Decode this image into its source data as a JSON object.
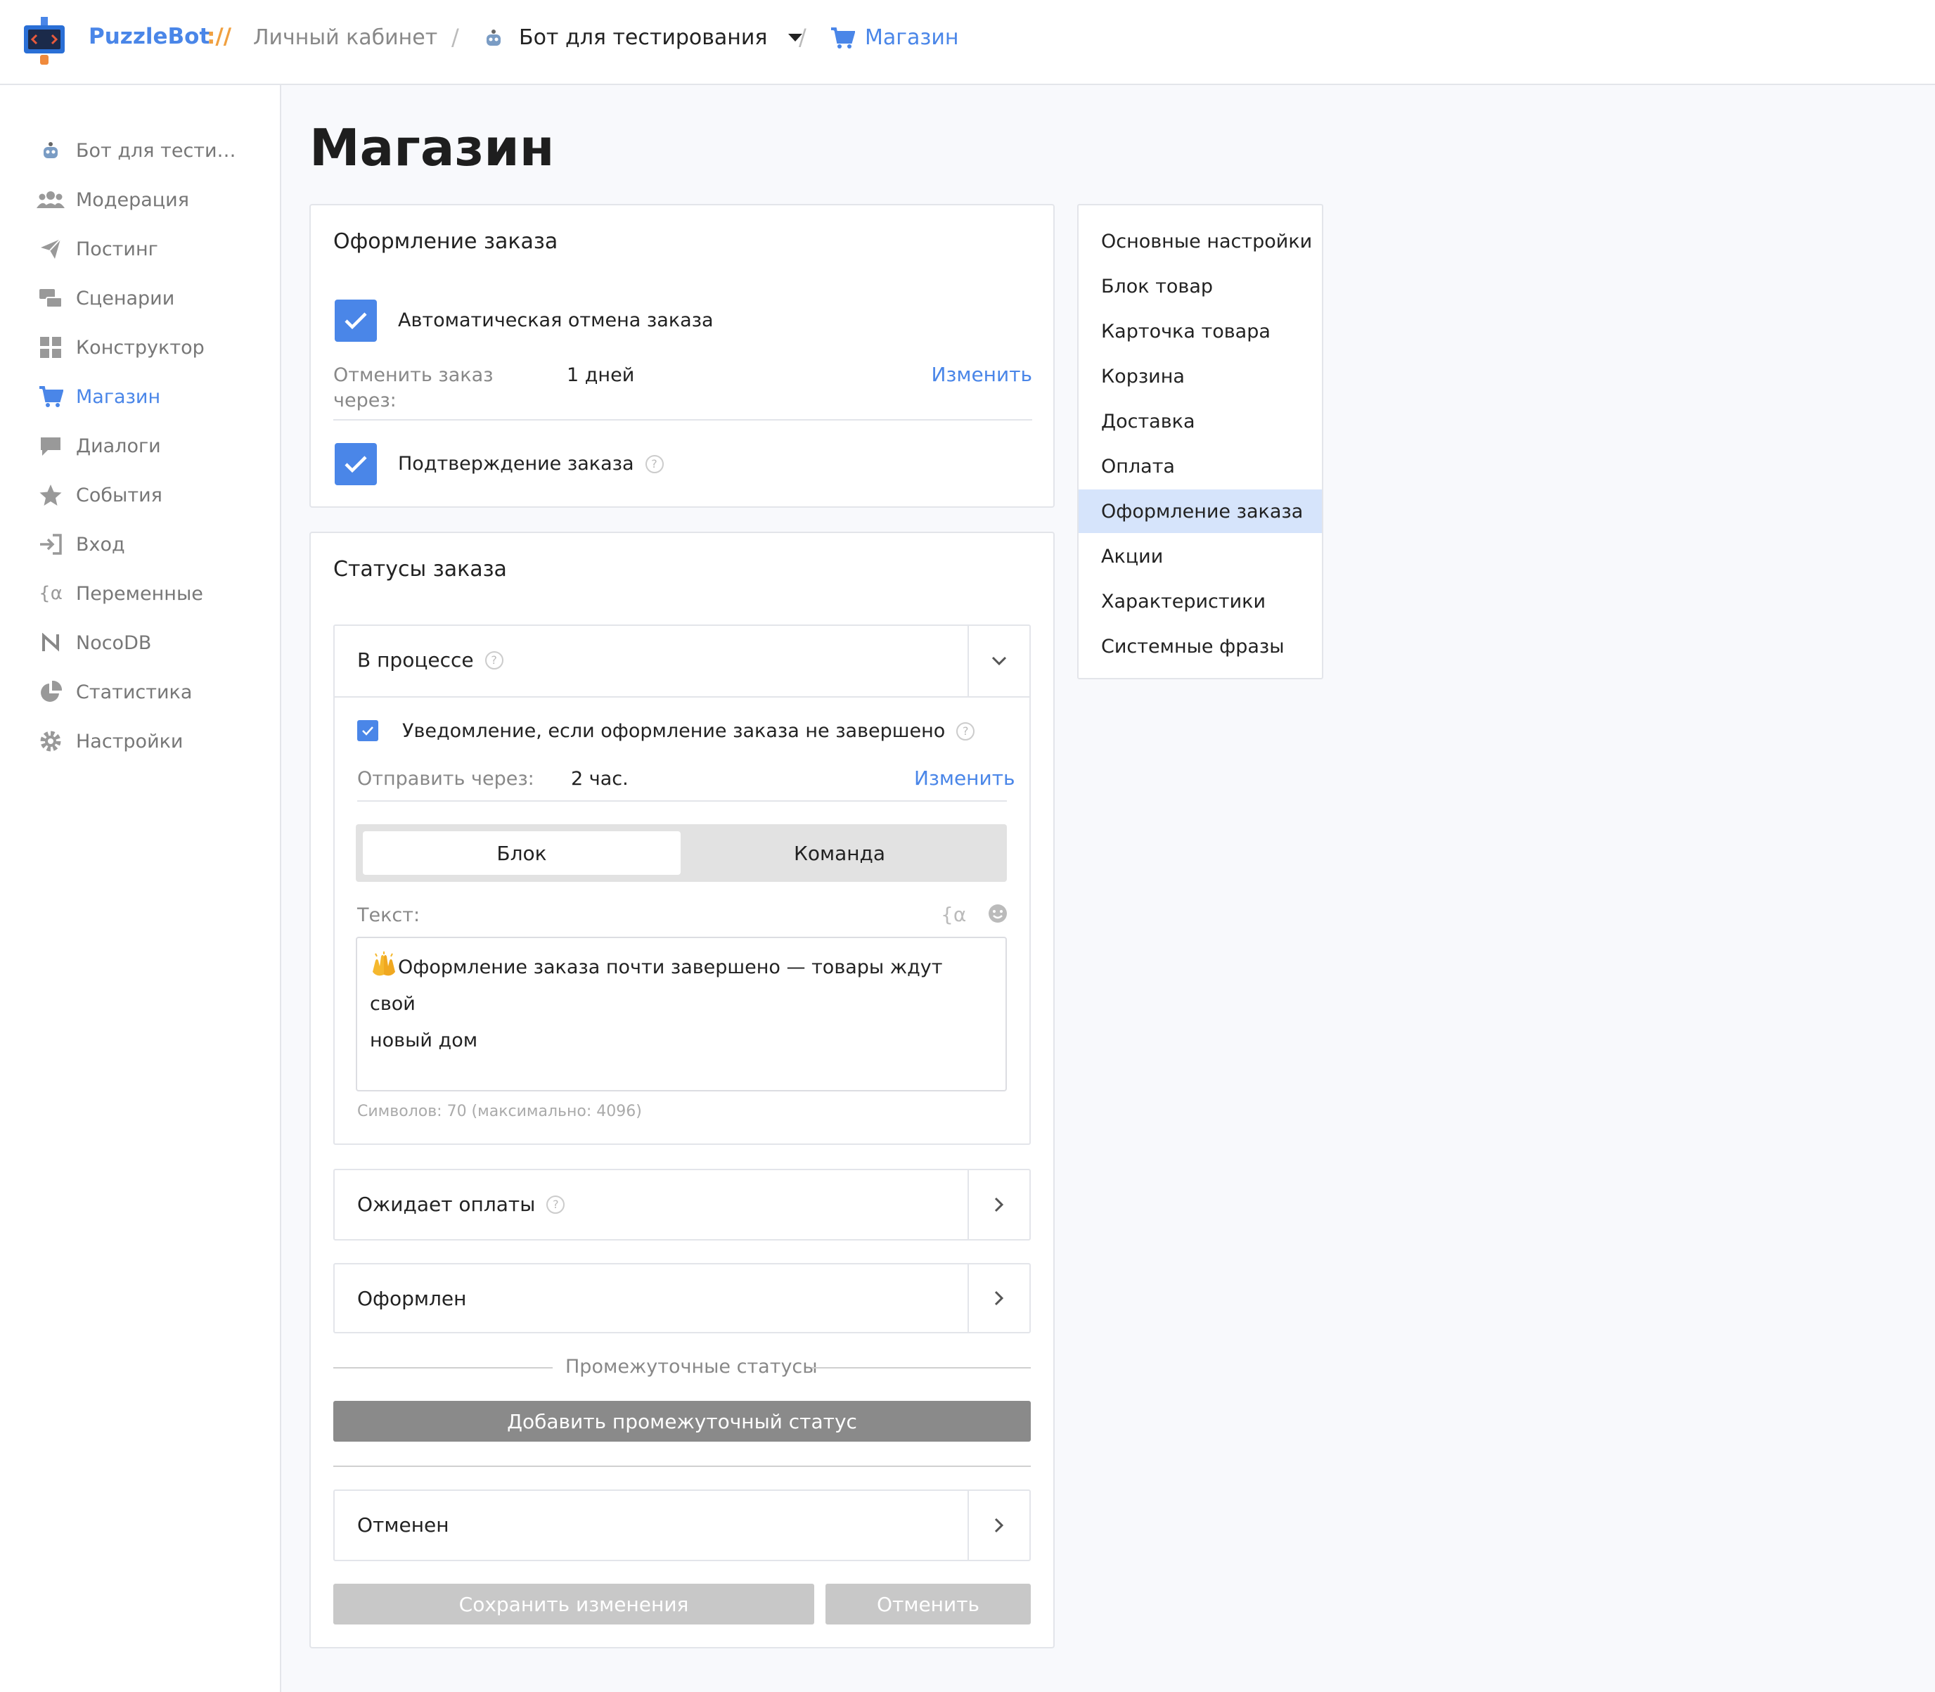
{
  "header": {
    "brand": "PuzzleBot",
    "brand_sep": "://",
    "crumb_cabinet": "Личный кабинет",
    "crumb_bot": "Бот для тестирования",
    "crumb_shop": "Магазин",
    "slash": "/"
  },
  "sidebar": {
    "items": [
      {
        "label": "Бот для тести…",
        "icon": "robot-icon"
      },
      {
        "label": "Модерация",
        "icon": "users-icon"
      },
      {
        "label": "Постинг",
        "icon": "paper-plane-icon"
      },
      {
        "label": "Сценарии",
        "icon": "scenarios-icon"
      },
      {
        "label": "Конструктор",
        "icon": "grid-icon"
      },
      {
        "label": "Магазин",
        "icon": "cart-icon",
        "active": true
      },
      {
        "label": "Диалоги",
        "icon": "chat-icon"
      },
      {
        "label": "События",
        "icon": "star-icon"
      },
      {
        "label": "Вход",
        "icon": "sign-in-icon"
      },
      {
        "label": "Переменные",
        "icon": "variable-icon"
      },
      {
        "label": "NocoDB",
        "icon": "nocodb-icon"
      },
      {
        "label": "Статистика",
        "icon": "pie-chart-icon"
      },
      {
        "label": "Настройки",
        "icon": "gear-icon"
      }
    ]
  },
  "main": {
    "title": "Магазин",
    "checkout": {
      "title": "Оформление заказа",
      "auto_cancel_label": "Автоматическая отмена заказа",
      "auto_cancel_checked": true,
      "cancel_after_label": "Отменить заказ через:",
      "cancel_after_value": "1 дней",
      "change_label": "Изменить",
      "confirm_label": "Подтверждение заказа",
      "confirm_checked": true
    },
    "statuses": {
      "title": "Статусы заказа",
      "in_progress": {
        "title": "В процессе",
        "notify_label": "Уведомление, если оформление заказа не завершено",
        "notify_checked": true,
        "send_after_label": "Отправить через:",
        "send_after_value": "2 час.",
        "change_label": "Изменить",
        "tab_block": "Блок",
        "tab_command": "Команда",
        "text_label": "Текст:",
        "text_value_line1": "Оформление заказа почти завершено — товары ждут свой",
        "text_value_line2": "новый дом",
        "counter": "Символов: 70 (максимально: 4096)"
      },
      "awaiting_payment": "Ожидает оплаты",
      "placed": "Оформлен",
      "intermediate_label": "Промежуточные статусы",
      "add_intermediate": "Добавить промежуточный статус",
      "cancelled": "Отменен",
      "save": "Сохранить изменения",
      "cancel": "Отменить"
    }
  },
  "rightnav": {
    "items": [
      {
        "label": "Основные настройки"
      },
      {
        "label": "Блок товар"
      },
      {
        "label": "Карточка товара"
      },
      {
        "label": "Корзина"
      },
      {
        "label": "Доставка"
      },
      {
        "label": "Оплата"
      },
      {
        "label": "Оформление заказа",
        "active": true
      },
      {
        "label": "Акции"
      },
      {
        "label": "Характеристики"
      },
      {
        "label": "Системные фразы"
      }
    ]
  },
  "colors": {
    "accent": "#4a86e8",
    "active_nav_bg": "#d6e4fb",
    "grey_button": "#8a8a8a",
    "disabled_button": "#c8c8c8"
  }
}
